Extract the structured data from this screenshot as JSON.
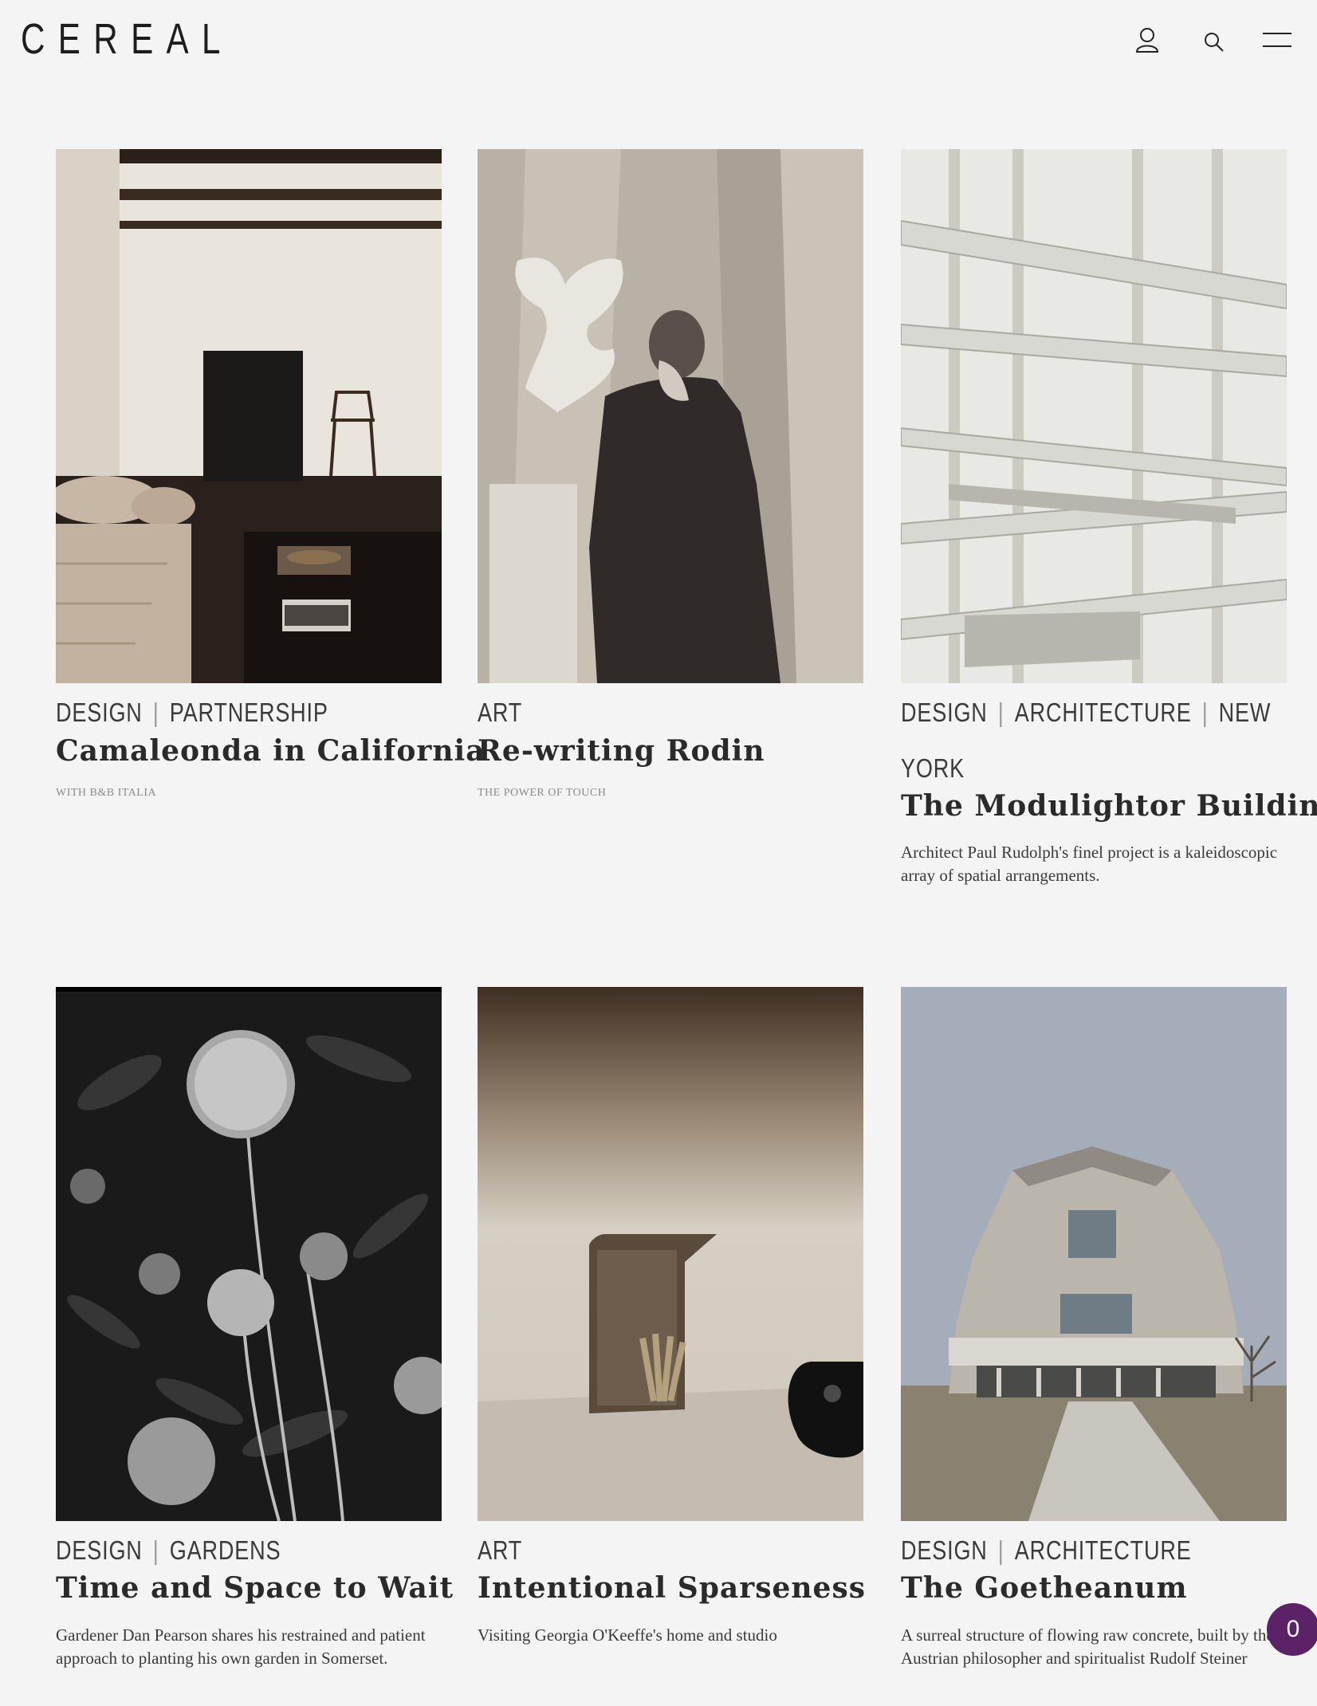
{
  "header": {
    "logo": "CEREAL",
    "icons": [
      "user-icon",
      "search-icon",
      "menu-icon"
    ]
  },
  "articles": [
    {
      "tags": [
        "DESIGN",
        "PARTNERSHIP"
      ],
      "title": "Camaleonda in California",
      "kicker": "WITH B&B ITALIA",
      "description": ""
    },
    {
      "tags": [
        "ART"
      ],
      "title": "Re-writing Rodin",
      "kicker": "THE POWER OF TOUCH",
      "description": ""
    },
    {
      "tags": [
        "DESIGN",
        "ARCHITECTURE",
        "NEW YORK"
      ],
      "title": "The Modulightor Building",
      "kicker": "",
      "description": "Architect Paul Rudolph's finel project is a kaleidoscopic array of spatial arrangements."
    },
    {
      "tags": [
        "DESIGN",
        "GARDENS"
      ],
      "title": "Time and Space to Wait",
      "kicker": "",
      "description": "Gardener Dan Pearson shares his restrained and patient approach to planting his own garden in Somerset."
    },
    {
      "tags": [
        "ART"
      ],
      "title": "Intentional Sparseness",
      "kicker": "",
      "description": "Visiting Georgia O'Keeffe's home and studio"
    },
    {
      "tags": [
        "DESIGN",
        "ARCHITECTURE"
      ],
      "title": "The Goetheanum",
      "kicker": "",
      "description": "A surreal structure of flowing raw concrete, built by the Austrian philosopher and spiritualist Rudolf Steiner"
    }
  ],
  "chat": {
    "badge": "0",
    "color": "#5b2268"
  },
  "colors": {
    "background": "#f4f4f4",
    "text": "#222222",
    "separator": "#9a9a9a"
  }
}
